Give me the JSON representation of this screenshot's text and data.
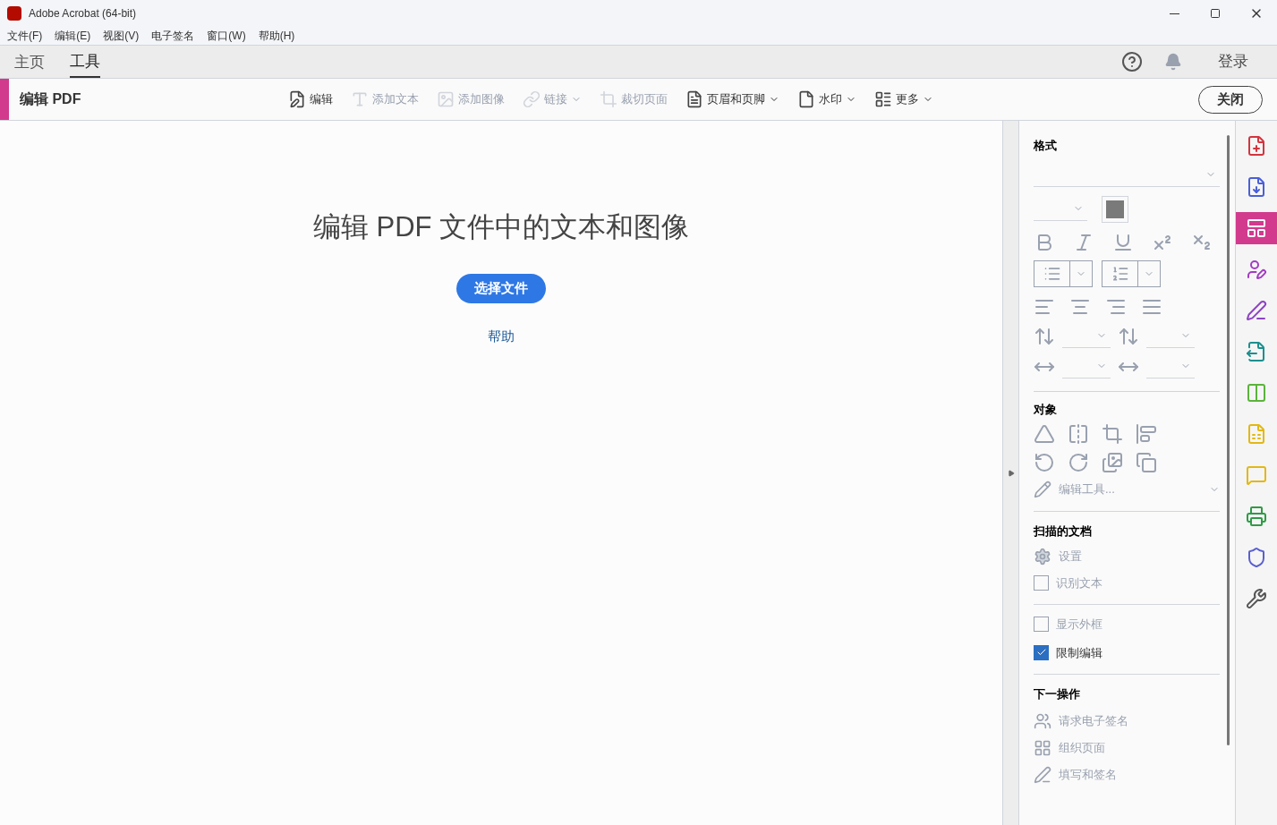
{
  "window": {
    "title": "Adobe Acrobat (64-bit)"
  },
  "menu": [
    "文件(F)",
    "编辑(E)",
    "视图(V)",
    "电子签名",
    "窗口(W)",
    "帮助(H)"
  ],
  "tabs": [
    {
      "label": "主页",
      "selected": false
    },
    {
      "label": "工具",
      "selected": true
    }
  ],
  "account": {
    "login": "登录"
  },
  "toolbar": {
    "title": "编辑 PDF",
    "close": "关闭",
    "tools": [
      {
        "kind": "edit",
        "label": "编辑",
        "disabled": false,
        "dropdown": false
      },
      {
        "kind": "text",
        "label": "添加文本",
        "disabled": true,
        "dropdown": false
      },
      {
        "kind": "image",
        "label": "添加图像",
        "disabled": true,
        "dropdown": false
      },
      {
        "kind": "link",
        "label": "链接",
        "disabled": true,
        "dropdown": true
      },
      {
        "kind": "crop",
        "label": "裁切页面",
        "disabled": true,
        "dropdown": false
      },
      {
        "kind": "header",
        "label": "页眉和页脚",
        "disabled": false,
        "dropdown": true
      },
      {
        "kind": "watermark",
        "label": "水印",
        "disabled": false,
        "dropdown": true
      },
      {
        "kind": "more",
        "label": "更多",
        "disabled": false,
        "dropdown": true
      }
    ]
  },
  "main": {
    "heading": "编辑 PDF 文件中的文本和图像",
    "button": "选择文件",
    "help": "帮助"
  },
  "panel": {
    "format": {
      "title": "格式"
    },
    "object": {
      "title": "对象",
      "tools": "编辑工具..."
    },
    "scanned": {
      "title": "扫描的文档",
      "items": [
        {
          "kind": "action",
          "label": "设置"
        },
        {
          "kind": "checkbox",
          "label": "识别文本",
          "checked": false
        }
      ]
    },
    "options": [
      {
        "label": "显示外框",
        "checked": false
      },
      {
        "label": "限制编辑",
        "checked": true
      }
    ],
    "next": {
      "title": "下一操作",
      "items": [
        {
          "kind": "sign",
          "label": "请求电子签名"
        },
        {
          "kind": "organize",
          "label": "组织页面"
        },
        {
          "kind": "fill",
          "label": "填写和签名"
        }
      ]
    }
  },
  "rail": [
    {
      "kind": "create",
      "selected": false
    },
    {
      "kind": "export",
      "selected": false
    },
    {
      "kind": "edit",
      "selected": true
    },
    {
      "kind": "sign",
      "selected": false
    },
    {
      "kind": "fill",
      "selected": false
    },
    {
      "kind": "send",
      "selected": false
    },
    {
      "kind": "organize",
      "selected": false
    },
    {
      "kind": "comment-file",
      "selected": false
    },
    {
      "kind": "comment",
      "selected": false
    },
    {
      "kind": "print",
      "selected": false
    },
    {
      "kind": "protect",
      "selected": false
    },
    {
      "kind": "more",
      "selected": false
    }
  ]
}
